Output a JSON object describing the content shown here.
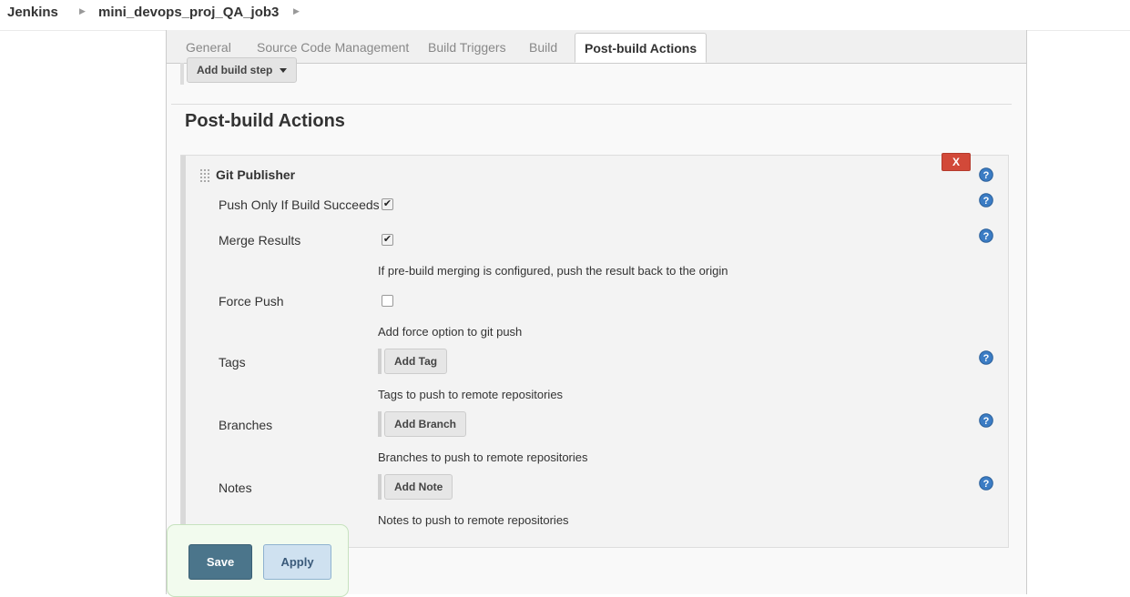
{
  "breadcrumb": {
    "items": [
      "Jenkins",
      "mini_devops_proj_QA_job3"
    ]
  },
  "tabs": [
    "General",
    "Source Code Management",
    "Build Triggers",
    "Build",
    "Post-build Actions"
  ],
  "active_tab": "Post-build Actions",
  "build": {
    "add_step_label": "Add build step"
  },
  "section_title": "Post-build Actions",
  "git_publisher": {
    "title": "Git Publisher",
    "delete_label": "X",
    "push_only_label": "Push Only If Build Succeeds",
    "push_only_checked": true,
    "merge_label": "Merge Results",
    "merge_checked": true,
    "merge_desc": "If pre-build merging is configured, push the result back to the origin",
    "force_label": "Force Push",
    "force_checked": false,
    "force_desc": "Add force option to git push",
    "tags_label": "Tags",
    "add_tag_label": "Add Tag",
    "tags_desc": "Tags to push to remote repositories",
    "branches_label": "Branches",
    "add_branch_label": "Add Branch",
    "branches_desc": "Branches to push to remote repositories",
    "notes_label": "Notes",
    "add_note_label": "Add Note",
    "notes_desc": "Notes to push to remote repositories"
  },
  "footer": {
    "save_label": "Save",
    "apply_label": "Apply"
  },
  "colors": {
    "delete_red": "#d24939",
    "save_blue": "#4b758b",
    "apply_light_blue": "#cfe1f0",
    "help_icon_blue": "#3b7cc4",
    "bottom_bar_green": "#f2fbee"
  },
  "icons": [
    "chevron-right-icon",
    "caret-down-icon",
    "drag-handle-icon",
    "help-icon",
    "checkmark-icon"
  ]
}
